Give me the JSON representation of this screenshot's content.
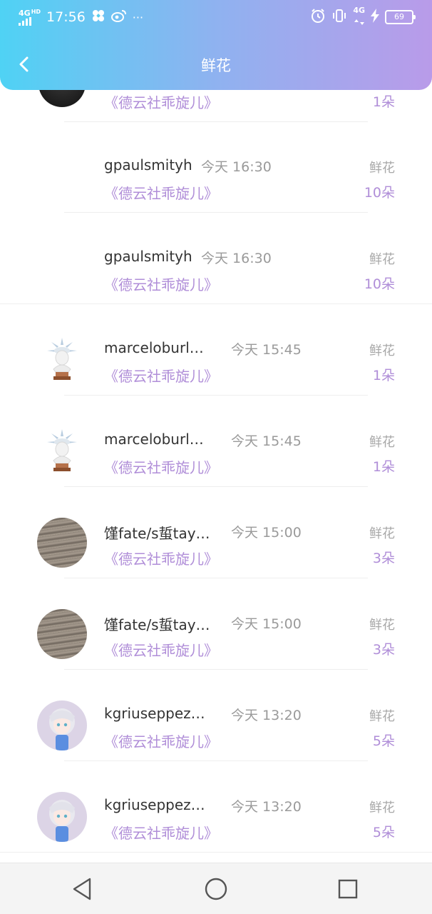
{
  "status_bar": {
    "network": "4G",
    "network_sup": "HD",
    "time": "17:56",
    "dots": "···",
    "network_right": "4G",
    "battery": "69"
  },
  "header": {
    "title": "鲜花"
  },
  "rows": [
    {
      "name": "",
      "time": "",
      "book": "《德云社乖旋儿》",
      "gift": "",
      "count": "1朵",
      "avatar": "dark-photo"
    },
    {
      "name": "gpaulsmityh",
      "time": "今天 16:30",
      "book": "《德云社乖旋儿》",
      "gift": "鲜花",
      "count": "10朵",
      "avatar": "none"
    },
    {
      "name": "gpaulsmityh",
      "time": "今天 16:30",
      "book": "《德云社乖旋儿》",
      "gift": "鲜花",
      "count": "10朵",
      "avatar": "none"
    },
    {
      "name": "marceloburlq…",
      "time": "今天 15:45",
      "book": "《德云社乖旋儿》",
      "gift": "鲜花",
      "count": "1朵",
      "avatar": "statue-of-liberty"
    },
    {
      "name": "marceloburlq…",
      "time": "今天 15:45",
      "book": "《德云社乖旋儿》",
      "gift": "鲜花",
      "count": "1朵",
      "avatar": "statue-of-liberty"
    },
    {
      "name": "馑fate/s蜇tay…",
      "time": "今天 15:00",
      "book": "《德云社乖旋儿》",
      "gift": "鲜花",
      "count": "3朵",
      "avatar": "handwriting-photo"
    },
    {
      "name": "馑fate/s蜇tay…",
      "time": "今天 15:00",
      "book": "《德云社乖旋儿》",
      "gift": "鲜花",
      "count": "3朵",
      "avatar": "handwriting-photo"
    },
    {
      "name": "kgriuseppeza…",
      "time": "今天 13:20",
      "book": "《德云社乖旋儿》",
      "gift": "鲜花",
      "count": "5朵",
      "avatar": "anime-girl"
    },
    {
      "name": "kgriuseppeza…",
      "time": "今天 13:20",
      "book": "《德云社乖旋儿》",
      "gift": "鲜花",
      "count": "5朵",
      "avatar": "anime-girl"
    }
  ],
  "colors": {
    "header_gradient_start": "#4fd2f4",
    "header_gradient_end": "#b99be9",
    "accent_purple": "#b08ed8"
  },
  "nav_icons": [
    "back-triangle-icon",
    "home-circle-icon",
    "recents-square-icon"
  ]
}
